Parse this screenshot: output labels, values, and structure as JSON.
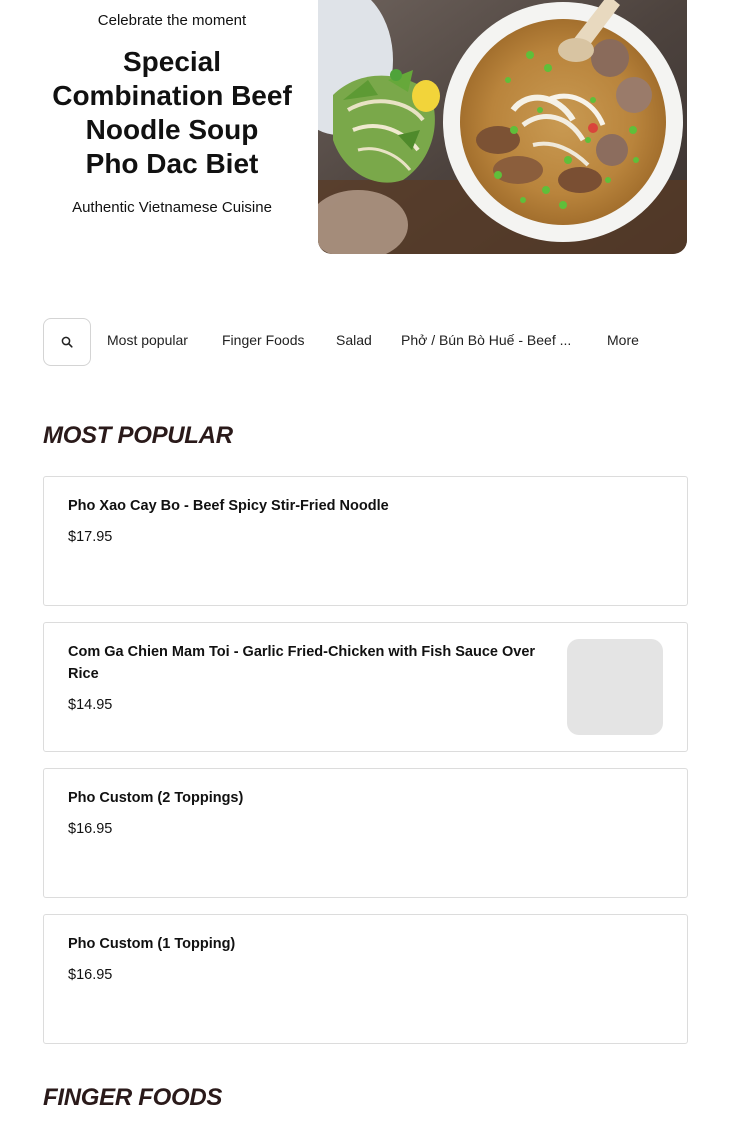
{
  "hero": {
    "tagline": "Celebrate the moment",
    "title_lines": [
      "Special",
      "Combination Beef",
      "Noodle Soup",
      "Pho Dac Biet"
    ],
    "subtitle": "Authentic Vietnamese Cuisine"
  },
  "nav": {
    "search_icon": "search-icon",
    "items": [
      "Most popular",
      "Finger Foods",
      "Salad",
      "Phở / Bún Bò Huế - Beef ...",
      "More"
    ]
  },
  "sections": [
    {
      "title": "MOST POPULAR",
      "items": [
        {
          "name": "Pho Xao Cay Bo - Beef Spicy Stir-Fried Noodle",
          "price": "$17.95"
        },
        {
          "name": "Com Ga Chien Mam Toi - Garlic Fried-Chicken with Fish Sauce Over Rice",
          "price": "$14.95"
        },
        {
          "name": "Pho Custom (2 Toppings)",
          "price": "$16.95"
        },
        {
          "name": "Pho Custom (1 Topping)",
          "price": "$16.95"
        }
      ]
    },
    {
      "title": "FINGER FOODS",
      "items": []
    }
  ],
  "colors": {
    "section_title": "#2a1a1a",
    "card_border": "#dcdcdc",
    "thumb_placeholder": "#e4e4e4"
  }
}
